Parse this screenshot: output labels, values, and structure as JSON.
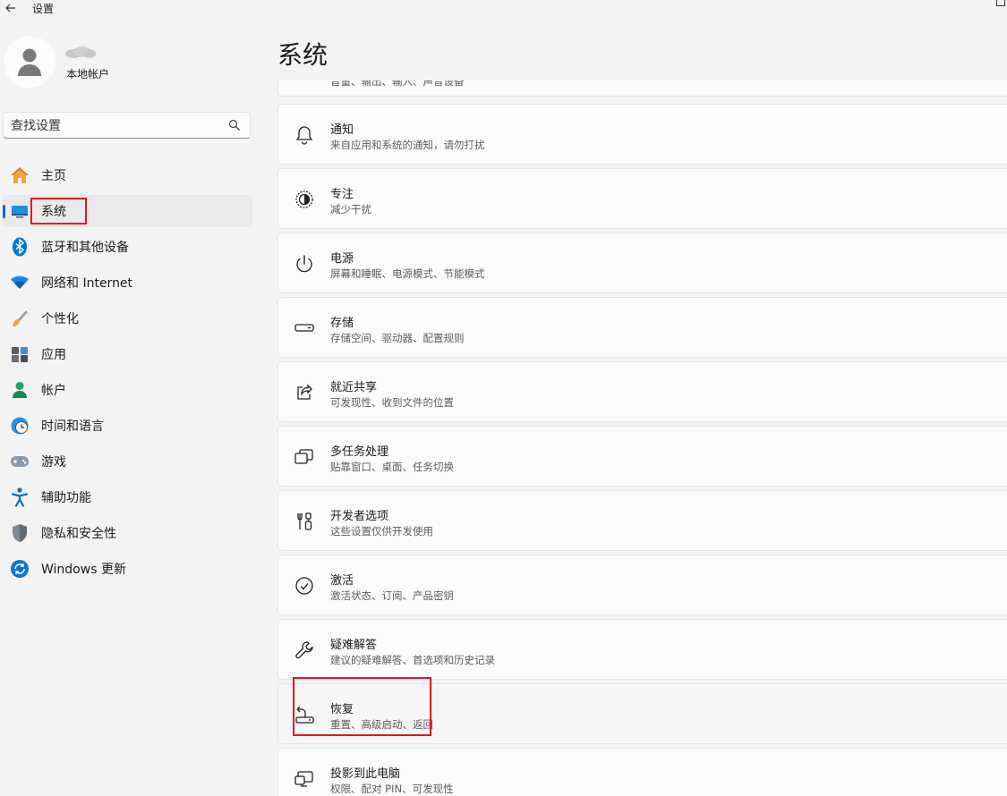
{
  "window": {
    "title": "设置"
  },
  "user": {
    "account_type": "本地帐户"
  },
  "search": {
    "placeholder": "查找设置"
  },
  "nav": {
    "items": [
      {
        "label": "主页",
        "icon": "home-icon"
      },
      {
        "label": "系统",
        "icon": "system-display-icon",
        "selected": true
      },
      {
        "label": "蓝牙和其他设备",
        "icon": "bluetooth-icon"
      },
      {
        "label": "网络和 Internet",
        "icon": "wifi-icon"
      },
      {
        "label": "个性化",
        "icon": "brush-icon"
      },
      {
        "label": "应用",
        "icon": "apps-icon"
      },
      {
        "label": "帐户",
        "icon": "account-icon"
      },
      {
        "label": "时间和语言",
        "icon": "globe-clock-icon"
      },
      {
        "label": "游戏",
        "icon": "gamepad-icon"
      },
      {
        "label": "辅助功能",
        "icon": "accessibility-icon"
      },
      {
        "label": "隐私和安全性",
        "icon": "shield-icon"
      },
      {
        "label": "Windows 更新",
        "icon": "update-icon"
      }
    ]
  },
  "main": {
    "title": "系统",
    "partial_sub": "音量、输出、输入、声音设备",
    "cards": [
      {
        "title": "通知",
        "sub": "来自应用和系统的通知，请勿打扰",
        "icon": "bell-icon"
      },
      {
        "title": "专注",
        "sub": "减少干扰",
        "icon": "focus-icon"
      },
      {
        "title": "电源",
        "sub": "屏幕和睡眠、电源模式、节能模式",
        "icon": "power-icon"
      },
      {
        "title": "存储",
        "sub": "存储空间、驱动器、配置规则",
        "icon": "storage-icon"
      },
      {
        "title": "就近共享",
        "sub": "可发现性、收到文件的位置",
        "icon": "share-icon"
      },
      {
        "title": "多任务处理",
        "sub": "贴靠窗口、桌面、任务切换",
        "icon": "multitask-icon"
      },
      {
        "title": "开发者选项",
        "sub": "这些设置仅供开发使用",
        "icon": "developer-tools-icon"
      },
      {
        "title": "激活",
        "sub": "激活状态、订阅、产品密钥",
        "icon": "check-circle-icon"
      },
      {
        "title": "疑难解答",
        "sub": "建议的疑难解答、首选项和历史记录",
        "icon": "wrench-icon"
      },
      {
        "title": "恢复",
        "sub": "重置、高级启动、返回",
        "icon": "recovery-icon"
      },
      {
        "title": "投影到此电脑",
        "sub": "权限、配对 PIN、可发现性",
        "icon": "project-icon"
      }
    ]
  },
  "colors": {
    "accent": "#0067c0",
    "highlight": "#e81123"
  }
}
